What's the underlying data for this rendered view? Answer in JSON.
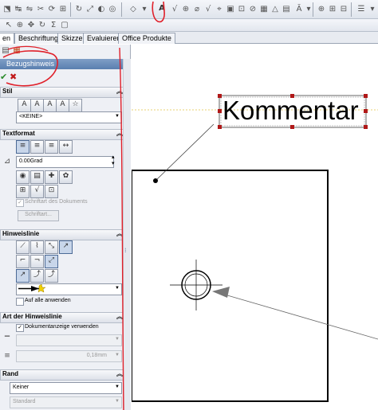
{
  "toolbar": {
    "row1_icons": [
      "sketch-icon",
      "smart-dimension-icon",
      "mirror-icon",
      "trim-icon",
      "convert-icon",
      "offset-icon",
      "rotate-icon",
      "scale-icon",
      "display-icon",
      "smart-icon",
      "balloon-icon",
      "auto-balloon-icon",
      "note-icon",
      "surface-finish-icon",
      "weld-symbol-icon",
      "hole-callout-icon",
      "datum-icon",
      "geometric-tolerance-icon",
      "datum-target-icon",
      "center-mark-icon",
      "centerline-icon",
      "area-hatch-icon",
      "block-icon",
      "revision-icon",
      "table-icon",
      "layer-icon"
    ],
    "row2_icons": [
      "select-icon",
      "zoom-icon",
      "pan-icon",
      "rotate-view-icon",
      "sum-icon",
      "view-icon"
    ]
  },
  "tabs": [
    {
      "label": "en",
      "active": true
    },
    {
      "label": "Beschriftung",
      "active": false
    },
    {
      "label": "Skizze",
      "active": false
    },
    {
      "label": "Evaluieren",
      "active": false
    },
    {
      "label": "Office Produkte",
      "active": false
    }
  ],
  "pm": {
    "title": "Bezugshinweis",
    "help": "?",
    "ok": "✔",
    "cancel": "✖",
    "sections": {
      "stil": {
        "label": "Stil",
        "combo": "<KEINE>"
      },
      "textformat": {
        "label": "Textformat",
        "angle": "0.00Grad",
        "font_doc_label": "Schriftart des Dokuments",
        "font_button": "Schriftart..."
      },
      "hinweislinie": {
        "label": "Hinweislinie",
        "apply_all": "Auf alle anwenden"
      },
      "art": {
        "label": "Art der Hinweislinie",
        "doc_display": "Dokumentanzeige verwenden",
        "thickness": "0,18mm"
      },
      "rand": {
        "label": "Rand",
        "combo1": "Keiner",
        "combo2": "Standard"
      }
    }
  },
  "drawing": {
    "note_text": "Kommentar",
    "accent": "#c0392b"
  },
  "colors": {
    "annotation_red": "#e0202a",
    "handle_red": "#b01818",
    "pm_title_blue": "#5a7fb0"
  }
}
